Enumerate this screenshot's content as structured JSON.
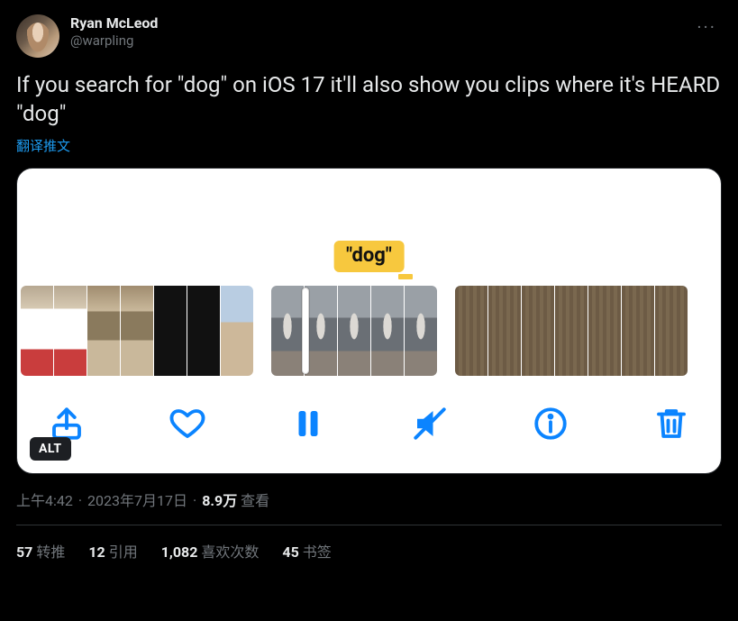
{
  "author": {
    "display_name": "Ryan McLeod",
    "handle": "@warpling"
  },
  "more_glyph": "···",
  "body_text": "If you search for \"dog\" on iOS 17 it'll also show you clips where it's HEARD \"dog\"",
  "translate_label": "翻译推文",
  "media": {
    "caption_tag": "\"dog\"",
    "alt_badge": "ALT",
    "toolbar": {
      "share": "share-icon",
      "like": "heart-icon",
      "pause": "pause-icon",
      "mute": "mute-icon",
      "info": "info-icon",
      "trash": "trash-icon"
    }
  },
  "meta": {
    "time": "上午4:42",
    "dot": "·",
    "date": "2023年7月17日",
    "views_count": "8.9万",
    "views_label": "查看"
  },
  "stats": {
    "retweets": {
      "count": "57",
      "label": "转推"
    },
    "quotes": {
      "count": "12",
      "label": "引用"
    },
    "likes": {
      "count": "1,082",
      "label": "喜欢次数"
    },
    "bookmarks": {
      "count": "45",
      "label": "书签"
    }
  }
}
